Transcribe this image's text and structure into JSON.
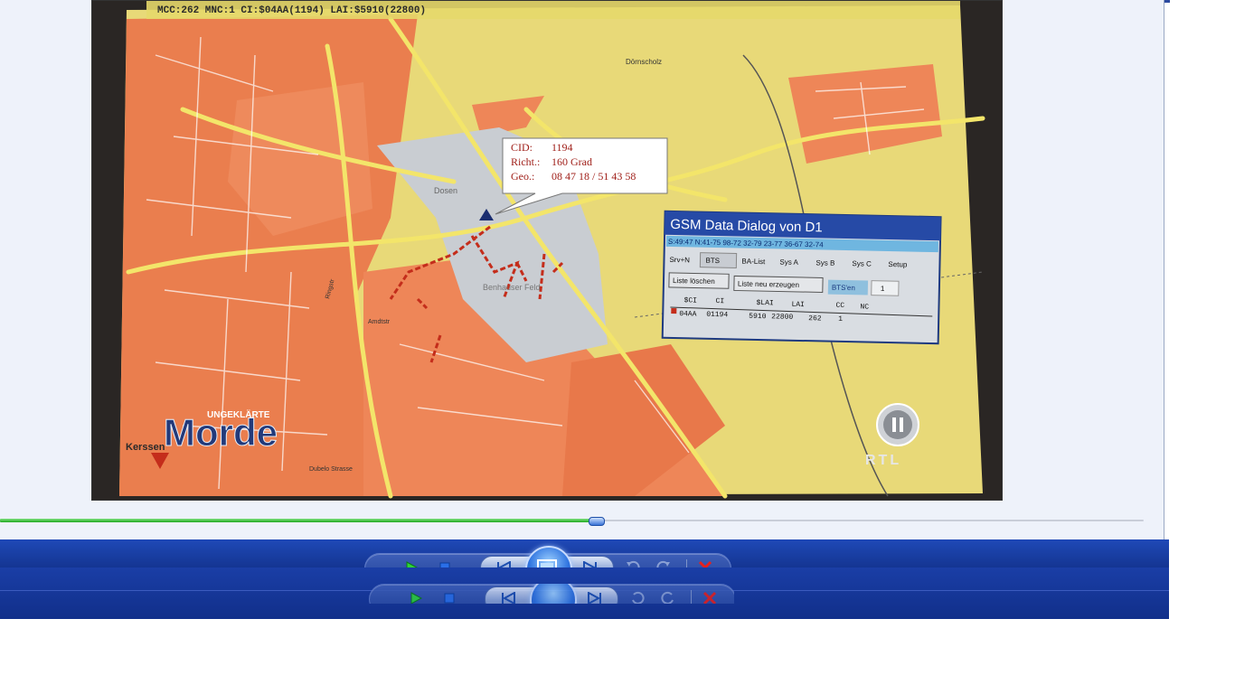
{
  "video": {
    "osd_text": "MCC:262 MNC:1 CI:$04AA(1194) LAI:$5910(22800)",
    "map_labels": {
      "place_dornscholz": "Dörnscholz",
      "place_dosen": "Dosen",
      "place_benhauser": "Benhauser Feld",
      "street_amdtstr": "Amdtstr",
      "street_ringstr": "Ringstr",
      "place_dubelo": "Dubelo Strasse"
    },
    "callout": {
      "cid_label": "CID:",
      "cid_value": "1194",
      "richt_label": "Richt.:",
      "richt_value": "160 Grad",
      "geo_label": "Geo.:",
      "geo_value": "08 47 18 / 51 43 58"
    },
    "gsm_dialog": {
      "title": "GSM Data Dialog von D1",
      "status_row": "S:49:47 N:41-75 98-72 32-79 23-77 36-67 32-74",
      "tabs": [
        "Srv+N",
        "BTS",
        "BA-List",
        "Sys A",
        "Sys B",
        "Sys C",
        "Setup"
      ],
      "btn_clear": "Liste löschen",
      "btn_new": "Liste neu erzeugen",
      "bts_label": "BTS'en",
      "bts_count": "1",
      "columns": [
        "$CI",
        "CI",
        "$LAI",
        "LAI",
        "CC",
        "NC"
      ],
      "row": [
        "04AA",
        "01194",
        "5910",
        "22800",
        "262",
        "1"
      ]
    },
    "logo": {
      "small": "UNGEKLÄRTE",
      "big": "Morde",
      "corner": "Kerssen"
    },
    "channel": "RTL"
  },
  "seek": {
    "progress": 0.521
  },
  "colors": {
    "accent": "#1f49b7",
    "seek": "#1ea81e"
  },
  "icons": {
    "play": "play-icon",
    "stop": "stop-icon",
    "prev": "previous-icon",
    "switch": "switch-view-icon",
    "next": "next-icon",
    "rewind": "rewind-icon",
    "forward": "forward-icon",
    "close": "close-icon"
  }
}
